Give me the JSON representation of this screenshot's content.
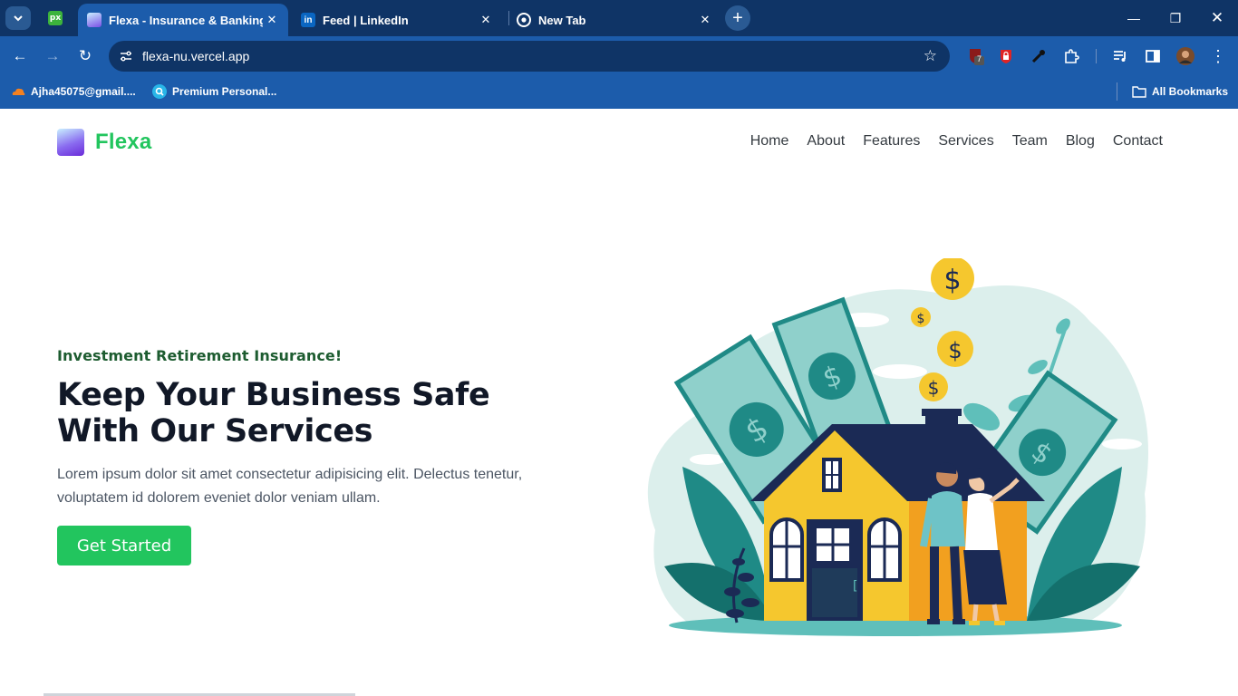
{
  "browser": {
    "tabs": [
      {
        "title": "Flexa - Insurance & Banking Fir",
        "active": true
      },
      {
        "title": "Feed | LinkedIn",
        "active": false
      },
      {
        "title": "New Tab",
        "active": false
      }
    ],
    "pinned_tab": {
      "label": "px"
    },
    "url": "flexa-nu.vercel.app",
    "bookmarks": [
      {
        "label": "Ajha45075@gmail...."
      },
      {
        "label": "Premium Personal..."
      }
    ],
    "all_bookmarks_label": "All Bookmarks",
    "ext_badge": "7"
  },
  "site": {
    "brand": "Flexa",
    "nav": [
      "Home",
      "About",
      "Features",
      "Services",
      "Team",
      "Blog",
      "Contact"
    ],
    "hero": {
      "tagline": "Investment Retirement Insurance!",
      "title_line1": "Keep Your Business Safe",
      "title_line2": "With Our Services",
      "text": "Lorem ipsum dolor sit amet consectetur adipisicing elit. Delectus tenetur, voluptatem id dolorem eveniet dolor veniam ullam.",
      "button": "Get Started"
    }
  },
  "colors": {
    "chrome_dark": "#0f3466",
    "chrome_mid": "#1c5cab",
    "brand_green": "#22c55e",
    "tagline_green": "#1d5c30",
    "title_dark": "#111827"
  }
}
